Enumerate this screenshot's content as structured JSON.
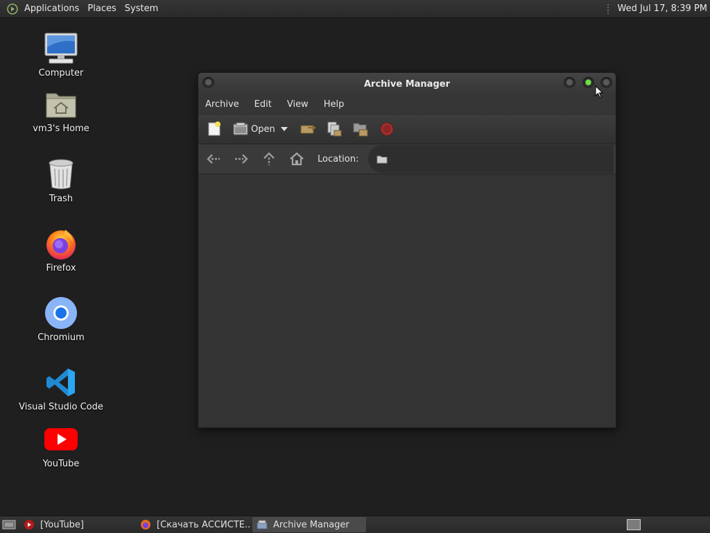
{
  "top_panel": {
    "menus": [
      "Applications",
      "Places",
      "System"
    ],
    "clock": "Wed Jul 17,  8:39 PM"
  },
  "desktop": {
    "icons": [
      {
        "label": "Computer",
        "icon": "computer-icon"
      },
      {
        "label": "vm3's Home",
        "icon": "home-folder-icon"
      },
      {
        "label": "Trash",
        "icon": "trash-icon"
      },
      {
        "label": "Firefox",
        "icon": "firefox-icon"
      },
      {
        "label": "Chromium",
        "icon": "chromium-icon"
      },
      {
        "label": "Visual Studio Code",
        "icon": "vscode-icon"
      },
      {
        "label": "YouTube",
        "icon": "youtube-icon"
      }
    ]
  },
  "window": {
    "title": "Archive Manager",
    "menu": [
      "Archive",
      "Edit",
      "View",
      "Help"
    ],
    "toolbar": {
      "open_label": "Open",
      "buttons": [
        "new-archive-icon",
        "open-icon",
        "extract-icon",
        "add-files-icon",
        "add-folder-icon",
        "stop-icon"
      ]
    },
    "location": {
      "label": "Location:",
      "value": ""
    }
  },
  "taskbar": {
    "tasks": [
      {
        "label": "[YouTube]",
        "icon": "youtube-icon",
        "active": false
      },
      {
        "label": "[Скачать АССИСТЕ...",
        "icon": "firefox-icon",
        "active": false
      },
      {
        "label": "Archive Manager",
        "icon": "archive-manager-icon",
        "active": true
      }
    ]
  },
  "colors": {
    "desktop_bg": "#1f1f1f",
    "panel_bg": "#2f2f2f",
    "window_bg": "#333333",
    "maximize_green": "#6fdc4a"
  }
}
